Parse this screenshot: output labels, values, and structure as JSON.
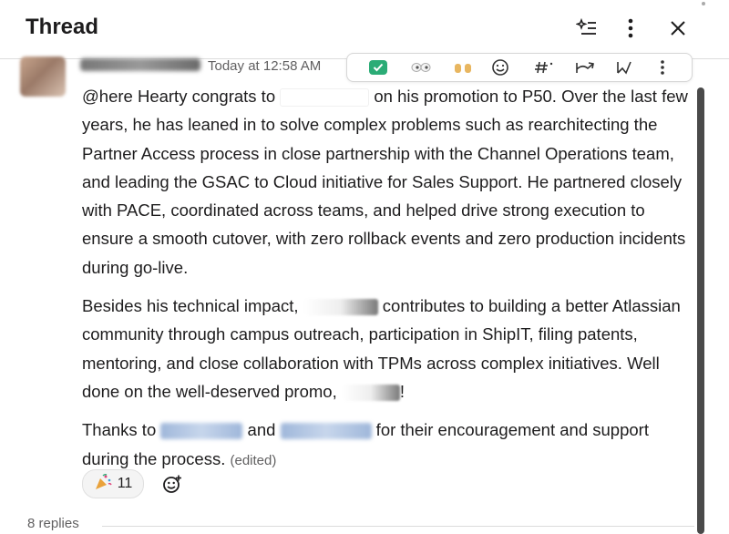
{
  "header": {
    "title": "Thread",
    "ai_icon": "sparkle-list-icon",
    "more_icon": "more-vertical-icon",
    "close_icon": "close-icon"
  },
  "message": {
    "timestamp": "Today at 12:58 AM",
    "mention": "@here",
    "p1_a": " Hearty congrats to ",
    "p1_b": " on his promotion to P50. Over the last few years, he has leaned in to solve complex problems such as rearchitecting the Partner Access process in close partnership with the Channel Operations team, and leading the GSAC to Cloud initiative for Sales Support. He partnered closely with PACE, coordinated across teams, and helped drive strong execution to ensure a smooth cutover, with zero rollback events and zero production incidents during go-live.",
    "p2_a": "Besides his technical impact, ",
    "p2_b": " contributes to building a better Atlassian community through campus outreach, participation in ShipIT, filing patents, mentoring, and close collaboration with TPMs across complex initiatives. Well done on the well-deserved promo, ",
    "p2_c": "!",
    "p3_a": "Thanks to ",
    "p3_b": " and ",
    "p3_c": " for their encouragement and support during the process.",
    "edited": "(edited)"
  },
  "message_actions": [
    {
      "icon": "check-mark-icon"
    },
    {
      "icon": "eyes-icon"
    },
    {
      "icon": "raised-hands-icon"
    },
    {
      "icon": "add-reaction-icon"
    },
    {
      "icon": "hashtag-icon"
    },
    {
      "icon": "forward-icon"
    },
    {
      "icon": "bookmark-icon"
    },
    {
      "icon": "more-vertical-icon"
    }
  ],
  "reactions": [
    {
      "emoji": "party-popper-icon",
      "count": "11"
    }
  ],
  "thread_footer": {
    "replies": "8 replies"
  },
  "colors": {
    "accent_green": "#2bac76",
    "text": "#1d1c1d",
    "muted": "#616061"
  }
}
